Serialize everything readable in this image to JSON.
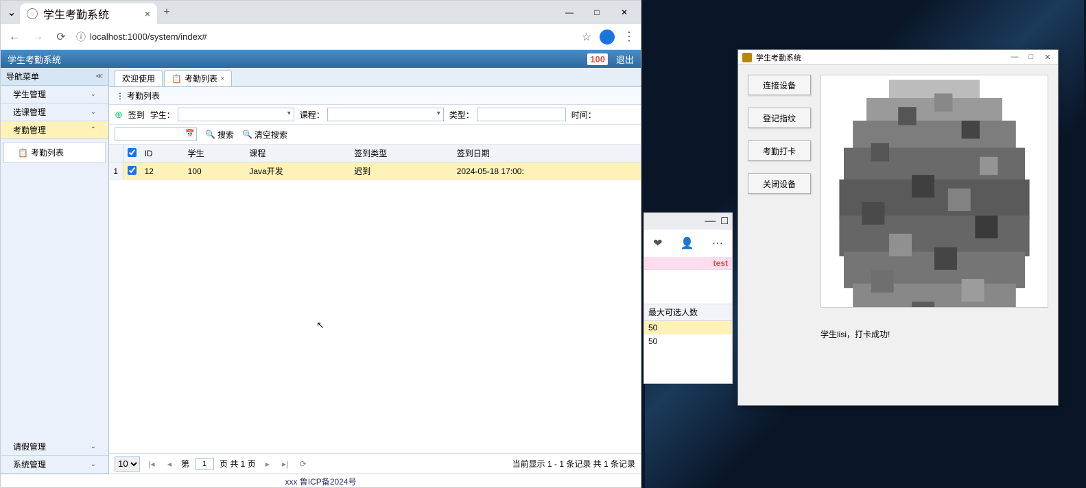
{
  "browser": {
    "tab_title": "学生考勤系统",
    "url": "localhost:1000/system/index#",
    "win_min": "—",
    "win_max": "□",
    "win_close": "✕"
  },
  "app": {
    "title": "学生考勤系统",
    "user_badge": "100",
    "logout": "退出"
  },
  "sidebar": {
    "nav_title": "导航菜单",
    "items": [
      {
        "label": "学生管理"
      },
      {
        "label": "选课管理"
      },
      {
        "label": "考勤管理"
      },
      {
        "label": "请假管理"
      },
      {
        "label": "系统管理"
      }
    ],
    "sub_item": "考勤列表"
  },
  "tabs": {
    "welcome": "欢迎使用",
    "list": "考勤列表"
  },
  "panel": {
    "title": "考勤列表",
    "signin": "签到",
    "student_label": "学生：",
    "course_label": "课程：",
    "type_label": "类型：",
    "time_label": "时间：",
    "search": "搜索",
    "clear": "清空搜索"
  },
  "grid": {
    "headers": {
      "id": "ID",
      "student": "学生",
      "course": "课程",
      "type": "签到类型",
      "date": "签到日期"
    },
    "rows": [
      {
        "n": "1",
        "id": "12",
        "student": "100",
        "course": "Java开发",
        "type": "迟到",
        "date": "2024-05-18 17:00:"
      }
    ]
  },
  "pager": {
    "size": "10",
    "page_prefix": "第",
    "page_value": "1",
    "page_suffix": "页 共 1 页",
    "info": "当前显示 1 - 1 条记录 共 1 条记录"
  },
  "footer": "xxx 鲁ICP备2024号",
  "mini": {
    "test": "test",
    "header": "最大可选人数",
    "rows": [
      "50",
      "50"
    ]
  },
  "jwin": {
    "title": "学生考勤系统",
    "btns": [
      "连接设备",
      "登记指纹",
      "考勤打卡",
      "关闭设备"
    ],
    "msg": "学生lisi，打卡成功!"
  }
}
